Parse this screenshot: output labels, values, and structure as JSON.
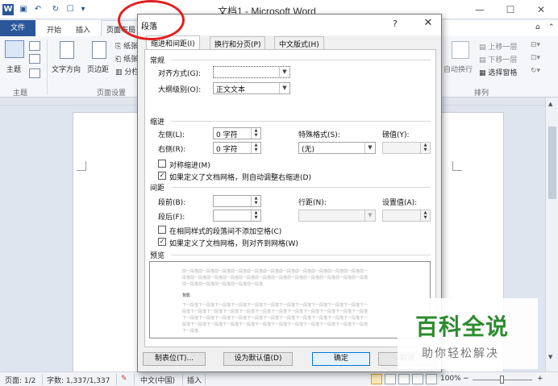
{
  "window": {
    "title": "文档1 - Microsoft Word",
    "minimize": "—",
    "maximize": "☐",
    "close": "✕"
  },
  "quick_access": {
    "save": "▣",
    "undo": "↶",
    "redo": "↻",
    "new": "☐",
    "more": "▾"
  },
  "ribbon": {
    "tabs": {
      "file": "文件",
      "home": "开始",
      "insert": "插入",
      "page_layout": "页面布局"
    },
    "buttons": {
      "themes": "主题",
      "text_direction": "文字方向",
      "margins": "页边距",
      "paper": "纸张",
      "paper2": "纸张",
      "columns": "分栏",
      "wrap": "自动换行",
      "bring_forward": "上移一层",
      "send_backward": "下移一层",
      "selection_pane": "选择窗格"
    },
    "groups": {
      "themes": "主题",
      "page_setup": "页面设置",
      "arrange": "排列"
    }
  },
  "statusbar": {
    "page": "页面: 1/2",
    "words": "字数: 1,337/1,337",
    "language": "中文(中国)",
    "insert_mode": "插入",
    "zoom": "100%",
    "zoom_minus": "−",
    "zoom_plus": "+"
  },
  "dialog": {
    "title": "段落",
    "help": "?",
    "close": "✕",
    "tabs": [
      "缩进和间距(I)",
      "换行和分页(P)",
      "中文版式(H)"
    ],
    "general": {
      "heading": "常规",
      "alignment_label": "对齐方式(G):",
      "alignment_value": "",
      "outline_label": "大纲级别(O):",
      "outline_value": "正文文本"
    },
    "indent": {
      "heading": "缩进",
      "left_label": "左侧(L):",
      "left_value": "0 字符",
      "right_label": "右侧(R):",
      "right_value": "0 字符",
      "special_label": "特殊格式(S):",
      "special_value": "(无)",
      "by_label": "磅值(Y):",
      "by_value": "",
      "mirror_label": "对称缩进(M)",
      "mirror_checked": false,
      "auto_adjust_label": "如果定义了文档网格，则自动调整右缩进(D)",
      "auto_adjust_checked": true
    },
    "spacing": {
      "heading": "间距",
      "before_label": "段前(B):",
      "before_value": "",
      "after_label": "段后(F):",
      "after_value": "",
      "line_label": "行距(N):",
      "line_value": "",
      "at_label": "设置值(A):",
      "at_value": "",
      "no_space_label": "在相同样式的段落间不添加空格(C)",
      "no_space_checked": false,
      "snap_grid_label": "如果定义了文档网格，则对齐到网格(W)",
      "snap_grid_checked": true
    },
    "preview": {
      "heading": "预览",
      "prev_lines": [
        "前一段落前一段落前一段落前一段落前一段落前一段落前一段落前一段落前一段落前一段落前一段落前一",
        "段落前一段落前一段落前一段落前一段落前一段落前一段落前一段落前一段落前一段落前一段落前一段落",
        "前一段落前一段落前一段落前一段落前一段落"
      ],
      "sample_label": "背影",
      "next_lines": [
        "下一段落下一段落下一段落下一段落下一段落下一段落下一段落下一段落下一段落下一段落下一段落下一",
        "段落下一段落下一段落下一段落下一段落下一段落下一段落下一段落下一段落下一段落下一段落下一段落",
        "下一段落下一段落下一段落下一段落下一段落下一段落下一段落下一段落下一段落下一段落下一段落下一",
        "段落下一段落下一段落下一段落下一段落下一段落下一段落下一段落下一段落下一段落下一段落下一段落",
        "下一段落"
      ]
    },
    "buttons": {
      "tabs": "制表位(T)...",
      "set_default": "设为默认值(D)",
      "ok": "确定",
      "cancel": "取消"
    }
  },
  "watermark": {
    "main": "百科全说",
    "sub": "助你轻松解决"
  },
  "annotation_color": "#e02020",
  "accent_color": "#2b579a"
}
